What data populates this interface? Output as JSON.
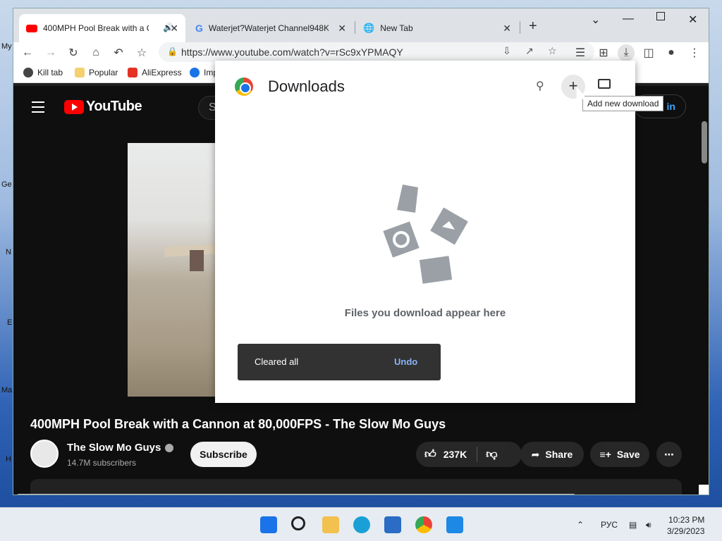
{
  "desktop": {
    "labels": [
      "My",
      "Ge",
      "N",
      "E",
      "Ma",
      "H"
    ]
  },
  "browser": {
    "tabs": [
      {
        "title": "400MPH Pool Break with a C",
        "icon": "youtube-icon",
        "audio": true
      },
      {
        "title": "Waterjet?Waterjet Channel948K",
        "icon": "google-icon"
      },
      {
        "title": "New Tab",
        "icon": "globe-icon"
      }
    ],
    "url": "https://www.youtube.com/watch?v=rSc9xYPMAQY",
    "bookmarks": [
      "Kill tab",
      "Popular",
      "AliExpress",
      "Imp"
    ]
  },
  "youtube": {
    "logo_text": "YouTube",
    "search_placeholder": "S",
    "signin_label": "in",
    "video_title": "400MPH Pool Break with a Cannon at 80,000FPS - The Slow Mo Guys",
    "channel_name": "The Slow Mo Guys",
    "subscribers": "14.7M subscribers",
    "subscribe_label": "Subscribe",
    "likes": "237K",
    "share_label": "Share",
    "save_label": "Save"
  },
  "downloads": {
    "title": "Downloads",
    "tooltip": "Add new download",
    "empty_text": "Files you download appear here",
    "toast_message": "Cleared all",
    "toast_action": "Undo"
  },
  "taskbar": {
    "language": "РУС",
    "time": "10:23 PM",
    "date": "3/29/2023"
  },
  "colors": {
    "youtube_red": "#ff0000",
    "link_blue": "#8ab4f8",
    "dark_bg": "#0f0f0f"
  }
}
